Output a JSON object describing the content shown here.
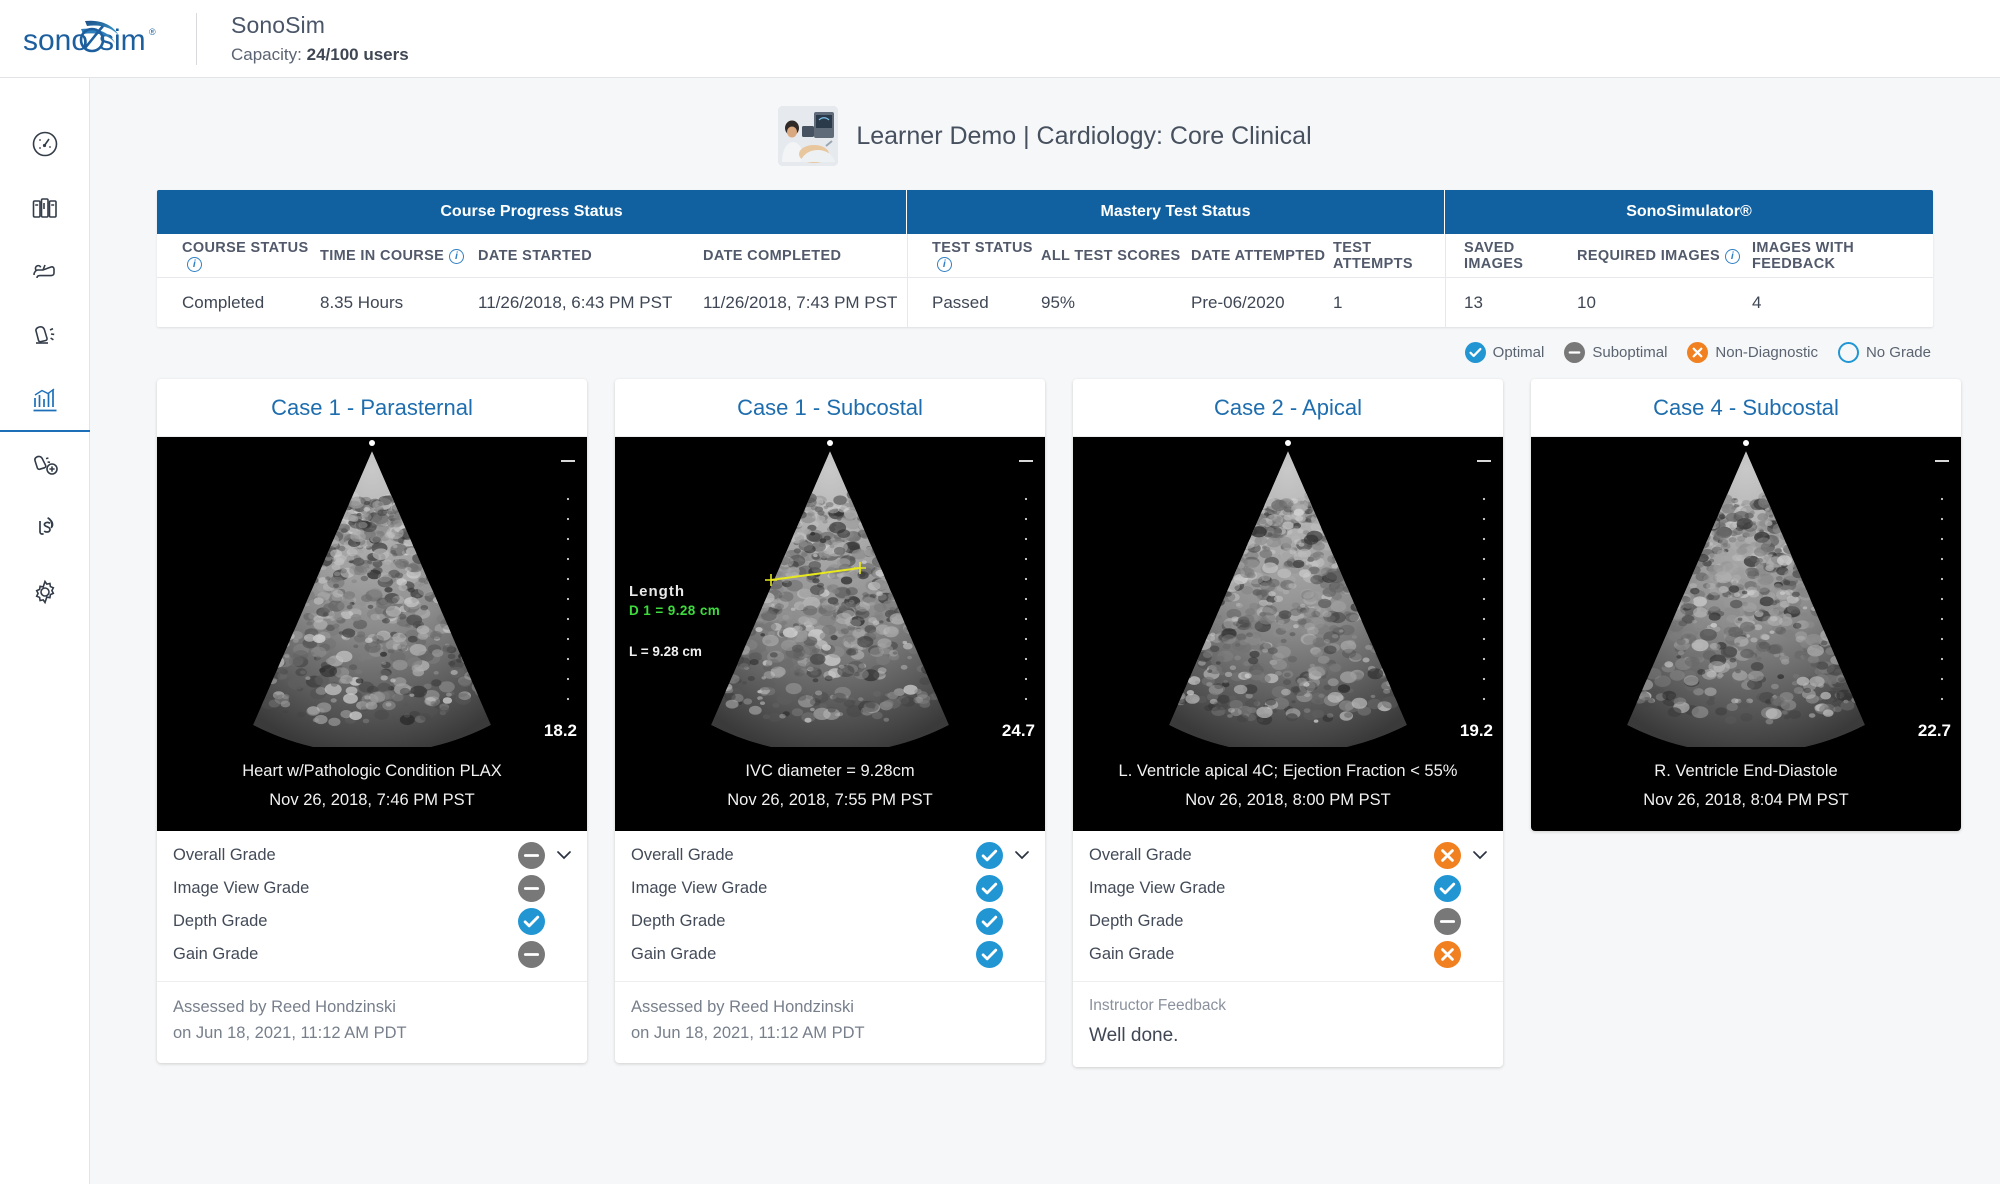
{
  "brand": {
    "logo_text": "sonosim",
    "title": "SonoSim",
    "capacity_label": "Capacity:",
    "capacity_value": "24/100 users"
  },
  "sidebar": {
    "items": [
      {
        "name": "dashboard",
        "icon": "gauge-icon",
        "active": false
      },
      {
        "name": "library",
        "icon": "books-icon",
        "active": false
      },
      {
        "name": "hands-on-scan",
        "icon": "hand-probe-icon",
        "active": false
      },
      {
        "name": "probe",
        "icon": "probe-icon",
        "active": false
      },
      {
        "name": "reports",
        "icon": "bar-chart-icon",
        "active": true
      },
      {
        "name": "add-case",
        "icon": "probe-add-icon",
        "active": false
      },
      {
        "name": "live-scan",
        "icon": "ls-logo-icon",
        "active": false
      },
      {
        "name": "settings",
        "icon": "gear-icon",
        "active": false
      }
    ]
  },
  "learner": {
    "title": "Learner Demo | Cardiology: Core Clinical",
    "thumbnail": "sonographer-photo"
  },
  "status_table": {
    "groups": [
      {
        "label": "Course Progress Status"
      },
      {
        "label": "Mastery Test Status"
      },
      {
        "label": "SonoSimulator®"
      }
    ],
    "columns": [
      {
        "label": "COURSE STATUS",
        "info": true
      },
      {
        "label": "TIME IN COURSE",
        "info": true
      },
      {
        "label": "DATE STARTED",
        "info": false
      },
      {
        "label": "DATE COMPLETED",
        "info": false
      },
      {
        "label": "TEST STATUS",
        "info": true
      },
      {
        "label": "ALL TEST SCORES",
        "info": false
      },
      {
        "label": "DATE ATTEMPTED",
        "info": false
      },
      {
        "label": "TEST ATTEMPTS",
        "info": false
      },
      {
        "label": "SAVED IMAGES",
        "info": false
      },
      {
        "label": "REQUIRED IMAGES",
        "info": true
      },
      {
        "label": "IMAGES WITH FEEDBACK",
        "info": false
      }
    ],
    "row": [
      "Completed",
      "8.35 Hours",
      "11/26/2018, 6:43 PM PST",
      "11/26/2018, 7:43 PM PST",
      "Passed",
      "95%",
      "Pre-06/2020",
      "1",
      "13",
      "10",
      "4"
    ]
  },
  "legend": [
    {
      "label": "Optimal",
      "type": "optimal"
    },
    {
      "label": "Suboptimal",
      "type": "suboptimal"
    },
    {
      "label": "Non-Diagnostic",
      "type": "nondiag"
    },
    {
      "label": "No Grade",
      "type": "nograde"
    }
  ],
  "grade_labels": {
    "overall": "Overall Grade",
    "image_view": "Image View Grade",
    "depth": "Depth Grade",
    "gain": "Gain Grade"
  },
  "cards": [
    {
      "title": "Case 1 - Parasternal",
      "caption": "Heart w/Pathologic Condition PLAX",
      "timestamp": "Nov 26, 2018, 7:46 PM PST",
      "depth": "18.2",
      "measurement": null,
      "grades": {
        "overall": "suboptimal",
        "image_view": "suboptimal",
        "depth": "optimal",
        "gain": "suboptimal"
      },
      "footer_type": "assessed",
      "assessed_by": "Assessed by Reed Hondzinski",
      "assessed_on": "on Jun 18, 2021, 11:12 AM PDT"
    },
    {
      "title": "Case 1 - Subcostal",
      "caption": "IVC diameter = 9.28cm",
      "timestamp": "Nov 26, 2018, 7:55 PM PST",
      "depth": "24.7",
      "measurement": {
        "label": "Length",
        "d1": "D 1 = 9.28 cm",
        "l": "L = 9.28 cm"
      },
      "grades": {
        "overall": "optimal",
        "image_view": "optimal",
        "depth": "optimal",
        "gain": "optimal"
      },
      "footer_type": "assessed",
      "assessed_by": "Assessed by Reed Hondzinski",
      "assessed_on": "on Jun 18, 2021, 11:12 AM PDT"
    },
    {
      "title": "Case 2 - Apical",
      "caption": "L. Ventricle apical 4C; Ejection Fraction < 55%",
      "timestamp": "Nov 26, 2018, 8:00 PM PST",
      "depth": "19.2",
      "measurement": null,
      "grades": {
        "overall": "nondiag",
        "image_view": "optimal",
        "depth": "suboptimal",
        "gain": "nondiag"
      },
      "footer_type": "feedback",
      "feedback_label": "Instructor Feedback",
      "feedback_text": "Well done."
    },
    {
      "title": "Case 4 - Subcostal",
      "caption": "R. Ventricle End-Diastole",
      "timestamp": "Nov 26, 2018, 8:04 PM PST",
      "depth": "22.7",
      "measurement": null,
      "grades": null,
      "footer_type": "none"
    }
  ],
  "colors": {
    "brand_blue": "#11609f",
    "optimal": "#2196d3",
    "suboptimal": "#787878",
    "nondiagnostic": "#f08020",
    "accent_link": "#1e6dae"
  }
}
